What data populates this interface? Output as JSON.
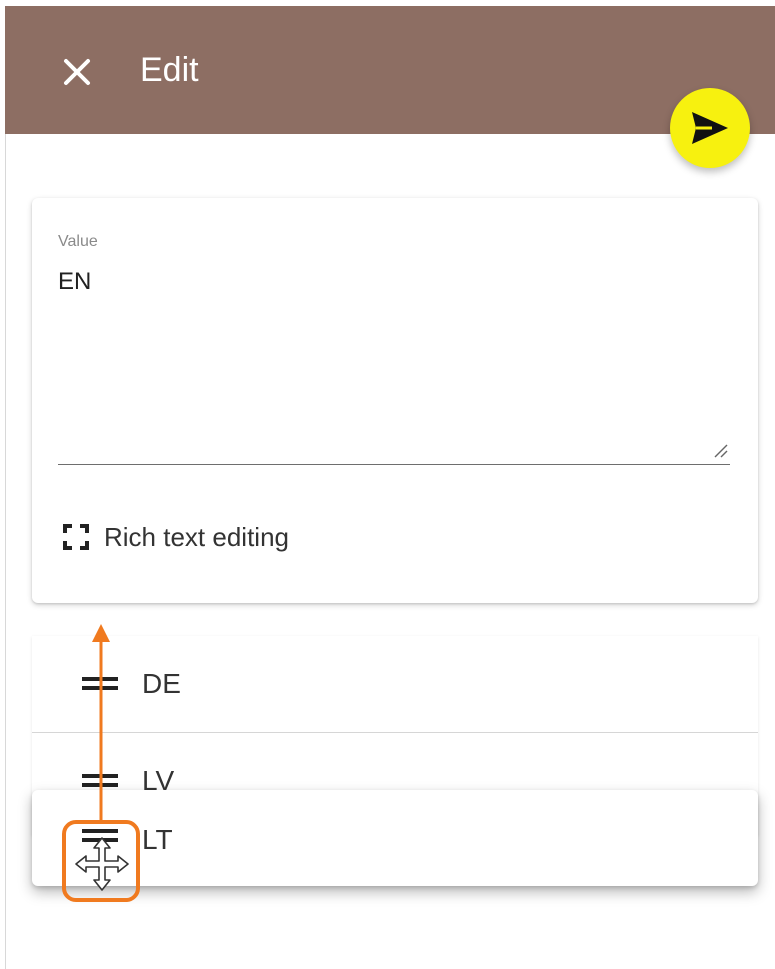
{
  "header": {
    "title": "Edit",
    "close_icon": "close-icon",
    "background_color": "#8d6e63"
  },
  "fab": {
    "icon": "send-icon",
    "color": "#f7f10f"
  },
  "form": {
    "value_label": "Value",
    "value_text": "EN",
    "rich_text_label": "Rich text editing",
    "rich_text_icon": "fullscreen-icon"
  },
  "list": {
    "items": [
      {
        "label": "DE",
        "icon": "drag-handle-icon"
      },
      {
        "label": "LV",
        "icon": "drag-handle-icon"
      }
    ],
    "dragging_item": {
      "label": "LT",
      "icon": "drag-handle-icon"
    }
  },
  "annotation": {
    "color": "#f07a1f",
    "cursor_icon": "move-cursor-icon"
  }
}
